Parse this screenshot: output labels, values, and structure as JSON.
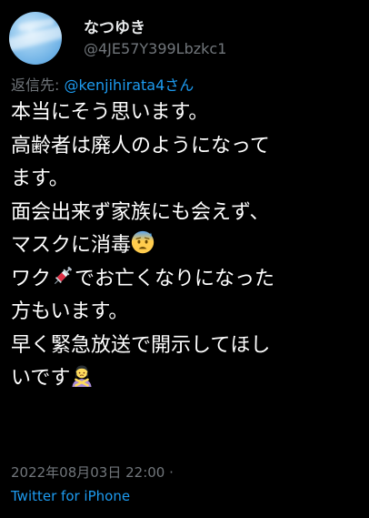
{
  "tweet": {
    "author": {
      "display_name": "なつゆき",
      "handle": "@4JE57Y399Lbzkc1",
      "avatar_icon": "sky-avatar-icon"
    },
    "reply_to": {
      "label": "返信先: ",
      "mention": "@kenjihirata4さん"
    },
    "body_lines": [
      {
        "text": "本当にそう思います。"
      },
      {
        "text": "高齢者は廃人のようになって"
      },
      {
        "text": "ます。"
      },
      {
        "text": "面会出来ず家族にも会えず、"
      },
      {
        "text": "マスクに消毒",
        "emoji": "anxious-face-with-sweat-icon"
      },
      {
        "before": "ワク",
        "emoji": "syringe-icon",
        "after": "でお亡くなりになった"
      },
      {
        "text": "方もいます。"
      },
      {
        "text": "早く緊急放送で開示してほし"
      },
      {
        "text": "いです",
        "emoji": "person-gesturing-no-icon"
      }
    ],
    "timestamp": "2022年08月03日 22:00 ·",
    "source": "Twitter for iPhone"
  },
  "colors": {
    "background": "#000000",
    "text": "#ffffff",
    "secondary": "#71767b",
    "link": "#1d9bf0"
  }
}
